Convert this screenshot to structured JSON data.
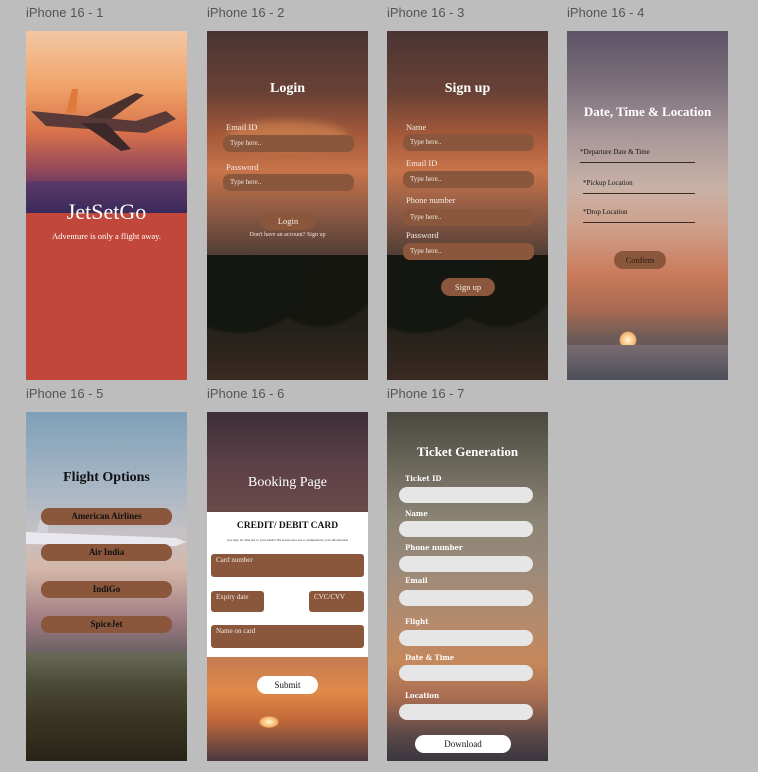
{
  "frames": {
    "f1": {
      "label": "iPhone 16 - 1",
      "title": "JetSetGo",
      "tagline": "Adventure is only a flight away."
    },
    "f2": {
      "label": "iPhone 16 - 2",
      "title": "Login",
      "email_label": "Email ID",
      "email_placeholder": "Type here..",
      "password_label": "Password",
      "password_placeholder": "Type here..",
      "button": "Login",
      "signup_text": "Don't have an account? Sign up"
    },
    "f3": {
      "label": "iPhone 16 - 3",
      "title": "Sign up",
      "name_label": "Name",
      "name_placeholder": "Type here..",
      "email_label": "Email ID",
      "email_placeholder": "Type here..",
      "phone_label": "Phone number",
      "phone_placeholder": "Type here..",
      "password_label": "Password",
      "password_placeholder": "Type here..",
      "button": "Sign up"
    },
    "f4": {
      "label": "iPhone 16 - 4",
      "title": "Date, Time & Location",
      "field1": "*Departure Date & Time",
      "field2": "*Pickup Location",
      "field3": "*Drop Location",
      "button": "Confirm"
    },
    "f5": {
      "label": "iPhone 16 - 5",
      "title": "Flight Options",
      "options": [
        "American Airlines",
        "Air India",
        "IndiGo",
        "SpiceJet"
      ]
    },
    "f6": {
      "label": "iPhone 16 - 6",
      "title": "Booking Page",
      "card_title": "CREDIT/ DEBIT CARD",
      "card_note": "you may be directed to your bank's 3D secure process to authenticate your information",
      "card_number": "Card number",
      "expiry": "Expiry date",
      "cvc": "CVC/CVV",
      "name_on_card": "Name on card",
      "button": "Submit"
    },
    "f7": {
      "label": "iPhone 16 - 7",
      "title": "Ticket Generation",
      "fields": [
        "Ticket ID",
        "Name",
        "Phone number",
        "Email",
        "Flight",
        "Date & Time",
        "Location"
      ],
      "button": "Download"
    }
  },
  "colors": {
    "background": "#bdbdbd",
    "accent_brown": "#8a573c",
    "splash_red": "#c1473a"
  }
}
